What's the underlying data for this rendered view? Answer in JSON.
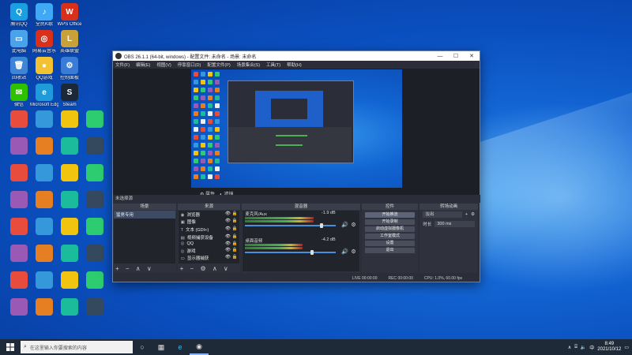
{
  "desktop_icons": [
    {
      "label": "腾讯QQ",
      "color": "#1aa0e0",
      "glyph": "Q"
    },
    {
      "label": "全民K歌",
      "color": "#3fa9f5",
      "glyph": "♪"
    },
    {
      "label": "WPS Office",
      "color": "#d9301c",
      "glyph": "W"
    },
    {
      "label": "此电脑",
      "color": "#4aa3e8",
      "glyph": "▭"
    },
    {
      "label": "网易云音乐",
      "color": "#d9301c",
      "glyph": "◎"
    },
    {
      "label": "英雄联盟",
      "color": "#c9a13b",
      "glyph": "L"
    },
    {
      "label": "回收站",
      "color": "#3d86d6",
      "glyph": "🗑"
    },
    {
      "label": "QQ游戏",
      "color": "#f2c232",
      "glyph": "●"
    },
    {
      "label": "控制面板",
      "color": "#3a7bd5",
      "glyph": "⚙"
    },
    {
      "label": "微信",
      "color": "#2dc100",
      "glyph": "✉"
    },
    {
      "label": "Microsoft Edge",
      "color": "#1f9bd9",
      "glyph": "e"
    },
    {
      "label": "Steam",
      "color": "#1b2838",
      "glyph": "S"
    }
  ],
  "obs": {
    "title": "OBS 26.1.1 (64-bit, windows) - 配置文件: 未命名 - 场景: 未命名",
    "menu": [
      "文件(F)",
      "编辑(E)",
      "视图(V)",
      "停靠窗口(D)",
      "配置文件(P)",
      "场景集合(S)",
      "工具(T)",
      "帮助(H)"
    ],
    "window_controls": [
      "—",
      "☐",
      "✕"
    ],
    "preview_controls": {
      "properties": "属性",
      "filters": "滤镜"
    },
    "no_source": "未选择源",
    "docks": {
      "scenes": "场景",
      "sources": "来源",
      "mixer": "混音器",
      "transitions": "转场动画",
      "controls": "控件"
    },
    "scenes": [
      "猛男专用"
    ],
    "sources": [
      {
        "glyph": "◉",
        "name": "浏览器"
      },
      {
        "glyph": "▣",
        "name": "图像"
      },
      {
        "glyph": "T",
        "name": "文本 (GDI+)"
      },
      {
        "glyph": "▤",
        "name": "视频捕获设备"
      },
      {
        "glyph": "◎",
        "name": "QQ"
      },
      {
        "glyph": "◎",
        "name": "游戏"
      },
      {
        "glyph": "▭",
        "name": "显示器捕获"
      }
    ],
    "mixer": [
      {
        "name": "麦克风/Aux",
        "db": "-1.9 dB",
        "level": 0.76,
        "volume": 0.82
      },
      {
        "name": "桌面音频",
        "db": "-4.2 dB",
        "level": 0.64,
        "volume": 0.72
      }
    ],
    "controls": [
      "开始推流",
      "开始录制",
      "启动虚拟摄像机",
      "工作室模式",
      "设置",
      "退出"
    ],
    "transition": {
      "type": "淡出",
      "duration_label": "时长",
      "duration": "300 ms"
    },
    "status": {
      "live_label": "LIVE",
      "live_time": "00:00:00",
      "rec_label": "REC",
      "rec_time": "00:00:00",
      "cpu": "CPU: 1.0%, 60.00 fps"
    },
    "dock_footer_glyphs": "+ − ∧ ∨"
  },
  "taskbar": {
    "search_placeholder": "在这里输入你要搜索的内容",
    "time": "8:49",
    "date": "2021/10/12",
    "tray_lang": "中",
    "tray_up": "∧"
  }
}
